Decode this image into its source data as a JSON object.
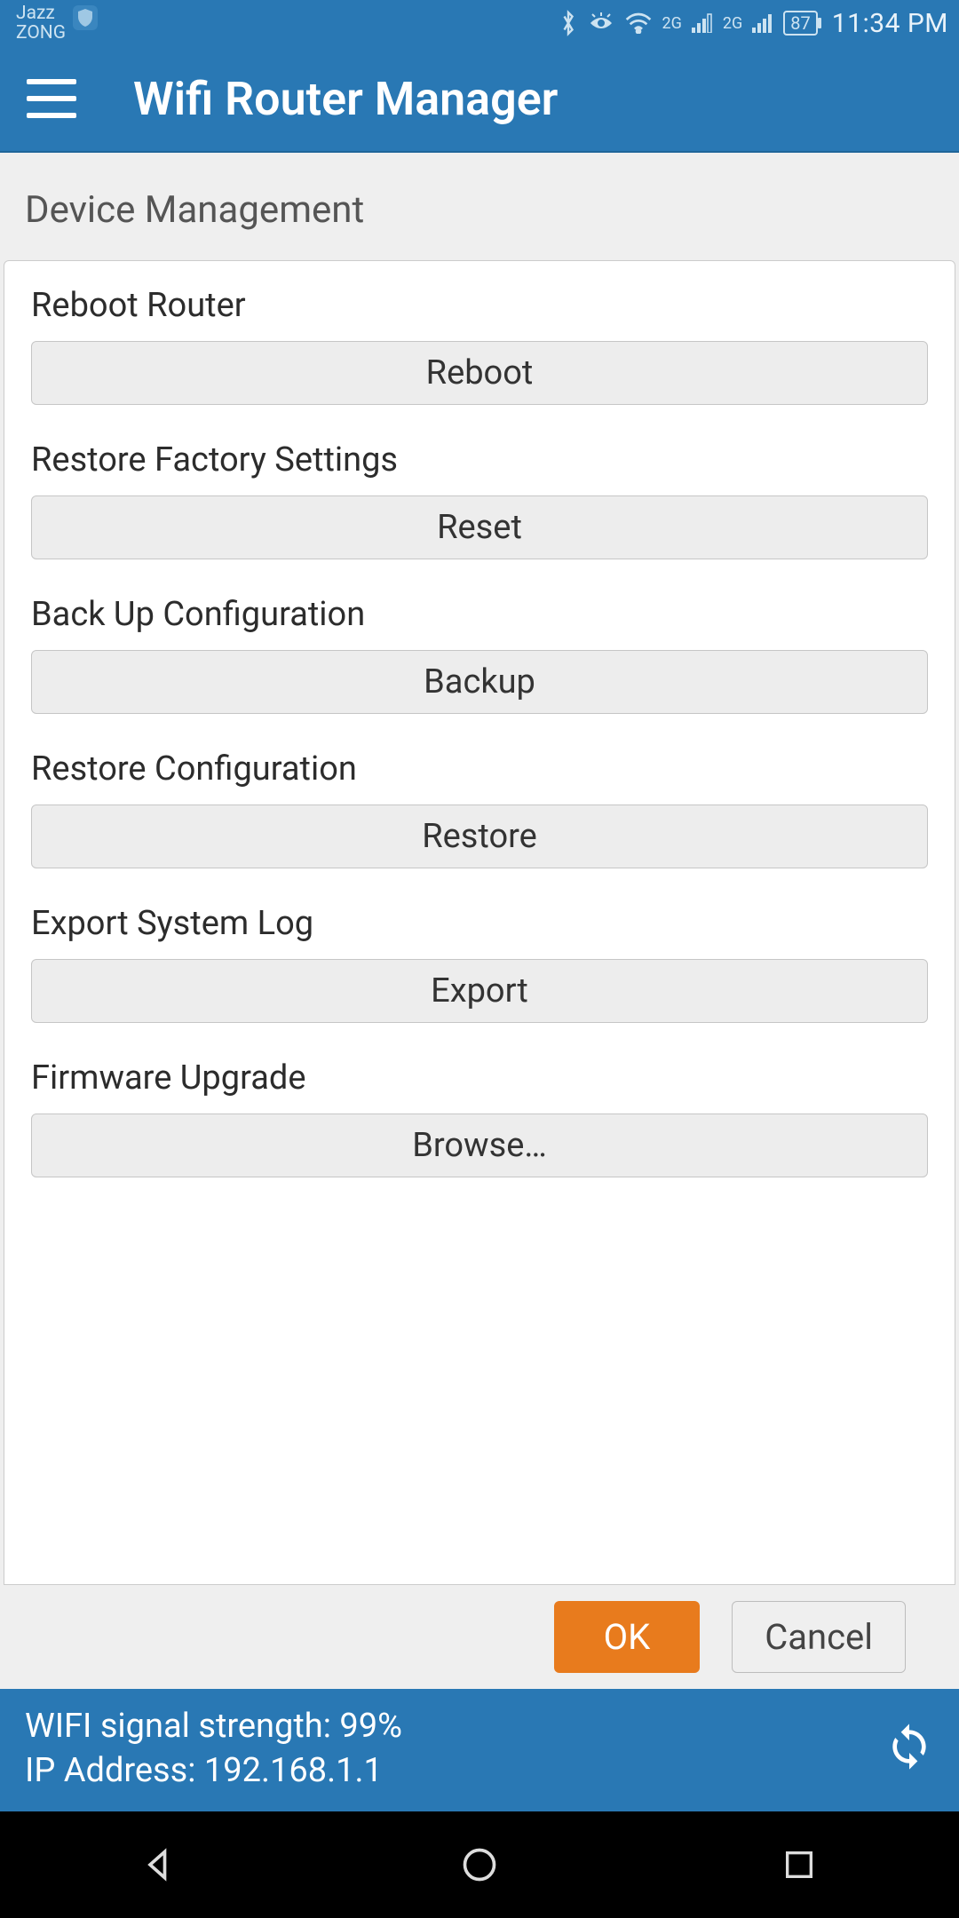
{
  "statusbar": {
    "carrier1": "Jazz",
    "carrier2": "ZONG",
    "net1": "2G",
    "net2": "2G",
    "battery": "87",
    "time": "11:34 PM"
  },
  "appbar": {
    "title": "Wifi Router Manager"
  },
  "page": {
    "section_title": "Device Management"
  },
  "groups": {
    "reboot": {
      "label": "Reboot Router",
      "button": "Reboot"
    },
    "reset": {
      "label": "Restore Factory Settings",
      "button": "Reset"
    },
    "backup": {
      "label": "Back Up Configuration",
      "button": "Backup"
    },
    "restore": {
      "label": "Restore Configuration",
      "button": "Restore"
    },
    "export": {
      "label": "Export System Log",
      "button": "Export"
    },
    "firmware": {
      "label": "Firmware Upgrade",
      "button": "Browse…"
    }
  },
  "actions": {
    "ok": "OK",
    "cancel": "Cancel"
  },
  "footer": {
    "signal": "WIFI signal strength: 99%",
    "ip": "IP Address: 192.168.1.1"
  }
}
